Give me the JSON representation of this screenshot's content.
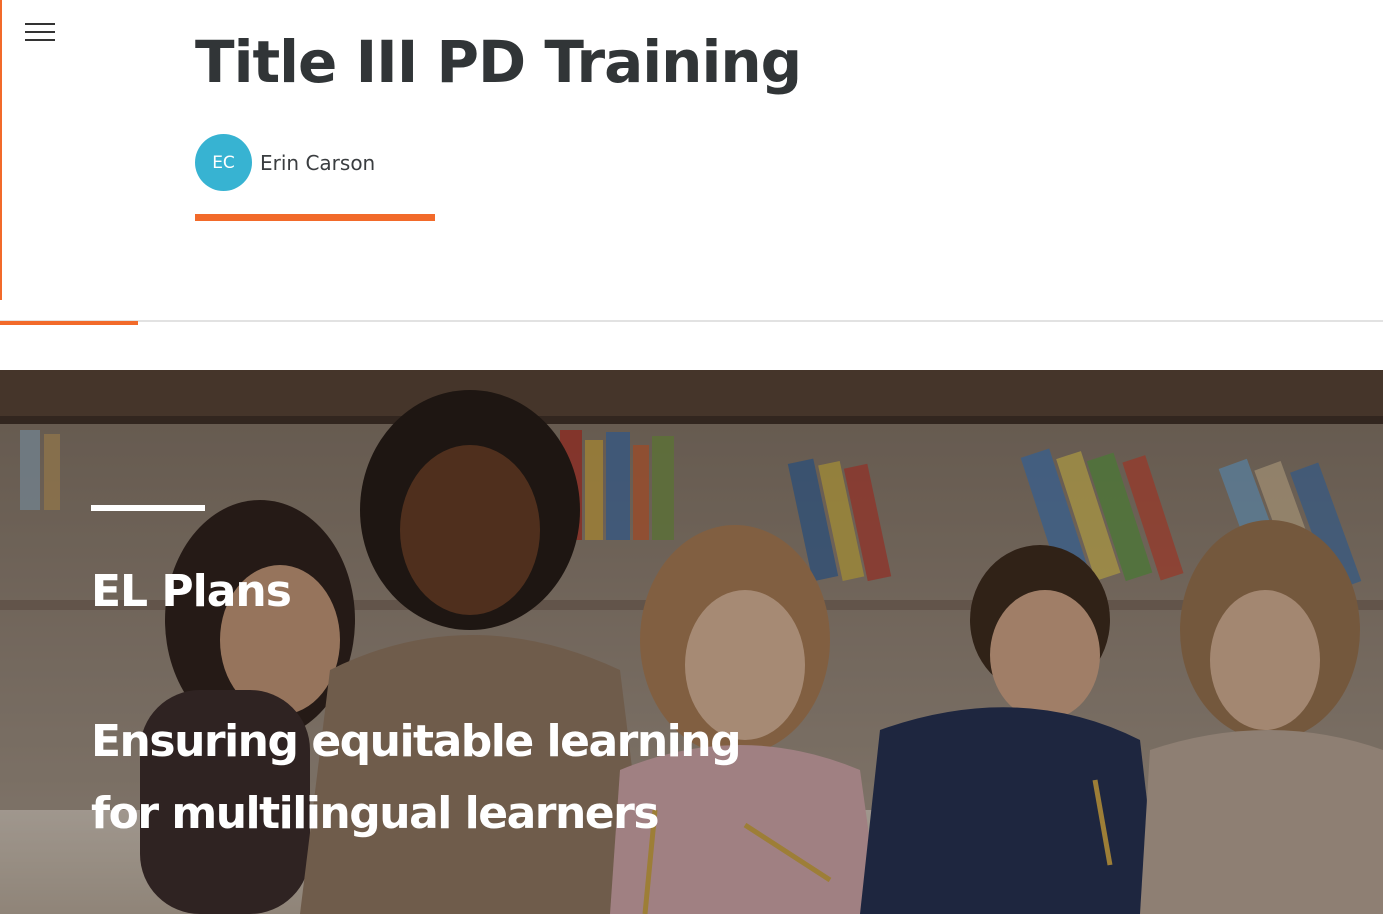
{
  "header": {
    "menu_icon": "hamburger-menu-icon",
    "course_title": "Title III PD Training",
    "author": {
      "initials": "EC",
      "name": "Erin Carson",
      "avatar_color": "#37b3d2"
    },
    "accent_color": "#f26a2a"
  },
  "progress": {
    "fraction": 0.1
  },
  "hero": {
    "image_icon": "classroom-photo",
    "heading": "EL Plans",
    "subtitle": "Ensuring equitable learning for multilingual learners"
  }
}
